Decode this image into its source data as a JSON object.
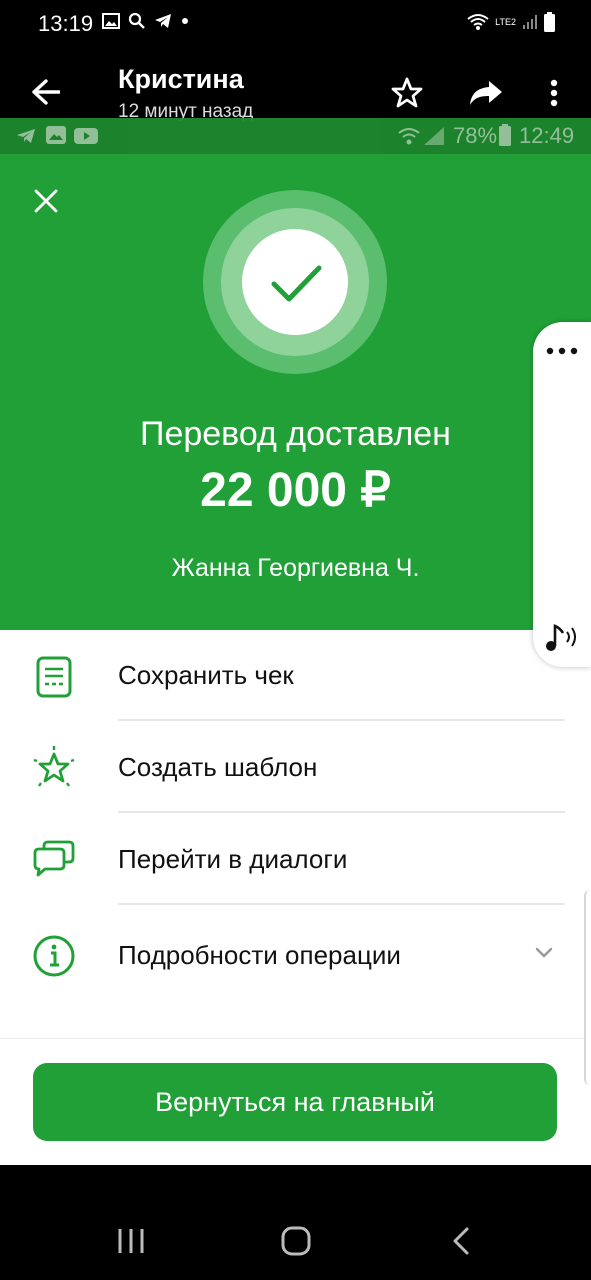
{
  "status_bar": {
    "time": "13:19",
    "network": "LTE2"
  },
  "app_bar": {
    "contact_name": "Кристина",
    "last_seen": "12 минут назад"
  },
  "inner_status_bar": {
    "battery": "78%",
    "time": "12:49"
  },
  "success": {
    "heading": "Перевод доставлен",
    "amount": "22 000 ₽",
    "recipient": "Жанна Георгиевна Ч."
  },
  "actions": [
    {
      "label": "Сохранить чек",
      "icon": "receipt-icon"
    },
    {
      "label": "Создать шаблон",
      "icon": "star-sparkle-icon"
    },
    {
      "label": "Перейти в диалоги",
      "icon": "chat-bubbles-icon"
    },
    {
      "label": "Подробности операции",
      "icon": "info-icon"
    }
  ],
  "primary_button": "Вернуться на главный",
  "colors": {
    "brand_green": "#21a038",
    "dark_bg": "#000000",
    "text": "#111111"
  }
}
